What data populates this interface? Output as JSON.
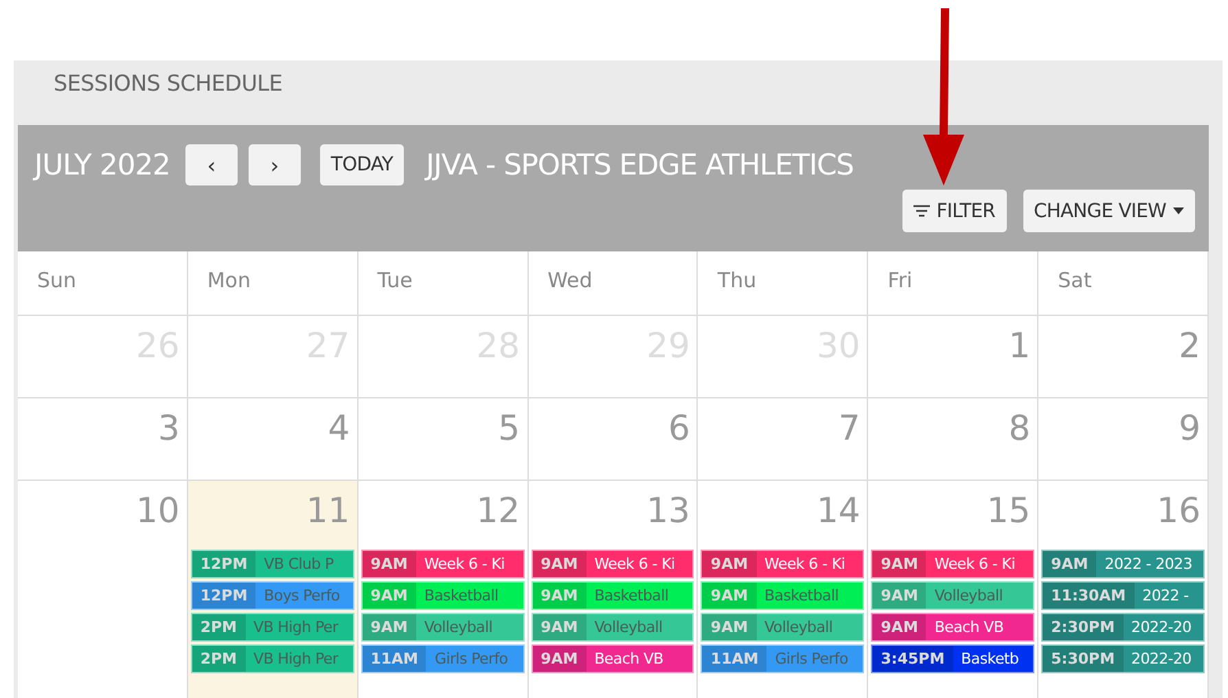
{
  "page_title": "SESSIONS SCHEDULE",
  "toolbar": {
    "month": "JULY 2022",
    "prev": "‹",
    "next": "›",
    "today": "TODAY",
    "venue": "JJVA - SPORTS EDGE ATHLETICS",
    "filter": "FILTER",
    "change_view": "CHANGE VIEW"
  },
  "weekdays": [
    "Sun",
    "Mon",
    "Tue",
    "Wed",
    "Thu",
    "Fri",
    "Sat"
  ],
  "weeks": [
    {
      "days": [
        {
          "number": "26",
          "other_month": true,
          "today": false
        },
        {
          "number": "27",
          "other_month": true,
          "today": false
        },
        {
          "number": "28",
          "other_month": true,
          "today": false
        },
        {
          "number": "29",
          "other_month": true,
          "today": false
        },
        {
          "number": "30",
          "other_month": true,
          "today": false
        },
        {
          "number": "1",
          "other_month": false,
          "today": false
        },
        {
          "number": "2",
          "other_month": false,
          "today": false
        }
      ]
    },
    {
      "days": [
        {
          "number": "3",
          "other_month": false,
          "today": false
        },
        {
          "number": "4",
          "other_month": false,
          "today": false
        },
        {
          "number": "5",
          "other_month": false,
          "today": false
        },
        {
          "number": "6",
          "other_month": false,
          "today": false
        },
        {
          "number": "7",
          "other_month": false,
          "today": false
        },
        {
          "number": "8",
          "other_month": false,
          "today": false
        },
        {
          "number": "9",
          "other_month": false,
          "today": false
        }
      ]
    },
    {
      "days": [
        {
          "number": "10",
          "other_month": false,
          "today": false
        },
        {
          "number": "11",
          "other_month": false,
          "today": true,
          "events": [
            {
              "time": "12PM",
              "title": "VB Club P",
              "color": "#19c08e"
            },
            {
              "time": "12PM",
              "title": "Boys Perfo",
              "color": "#3399f5"
            },
            {
              "time": "2PM",
              "title": "VB High Per",
              "color": "#19c08e"
            },
            {
              "time": "2PM",
              "title": "VB High Per",
              "color": "#19c08e"
            }
          ]
        },
        {
          "number": "12",
          "other_month": false,
          "today": false,
          "events": [
            {
              "time": "9AM",
              "title": "Week 6 - Ki",
              "color": "#ff2d6b"
            },
            {
              "time": "9AM",
              "title": "Basketball",
              "color": "#00ee55"
            },
            {
              "time": "9AM",
              "title": "Volleyball",
              "color": "#35c795"
            },
            {
              "time": "11AM",
              "title": "Girls Perfo",
              "color": "#3399f5"
            }
          ]
        },
        {
          "number": "13",
          "other_month": false,
          "today": false,
          "events": [
            {
              "time": "9AM",
              "title": "Week 6 - Ki",
              "color": "#ff2d6b"
            },
            {
              "time": "9AM",
              "title": "Basketball",
              "color": "#00ee55"
            },
            {
              "time": "9AM",
              "title": "Volleyball",
              "color": "#35c795"
            },
            {
              "time": "9AM",
              "title": "Beach VB",
              "color": "#f0288f"
            }
          ]
        },
        {
          "number": "14",
          "other_month": false,
          "today": false,
          "events": [
            {
              "time": "9AM",
              "title": "Week 6 - Ki",
              "color": "#ff2d6b"
            },
            {
              "time": "9AM",
              "title": "Basketball",
              "color": "#00ee55"
            },
            {
              "time": "9AM",
              "title": "Volleyball",
              "color": "#35c795"
            },
            {
              "time": "11AM",
              "title": "Girls Perfo",
              "color": "#3399f5"
            }
          ]
        },
        {
          "number": "15",
          "other_month": false,
          "today": false,
          "events": [
            {
              "time": "9AM",
              "title": "Week 6 - Ki",
              "color": "#ff2d6b"
            },
            {
              "time": "9AM",
              "title": "Volleyball",
              "color": "#35c795"
            },
            {
              "time": "9AM",
              "title": "Beach VB",
              "color": "#f0288f"
            },
            {
              "time": "3:45PM",
              "title": "Basketb",
              "color": "#0030f0"
            }
          ]
        },
        {
          "number": "16",
          "other_month": false,
          "today": false,
          "events": [
            {
              "time": "9AM",
              "title": "2022 - 2023",
              "color": "#27958d"
            },
            {
              "time": "11:30AM",
              "title": "2022 -",
              "color": "#27958d"
            },
            {
              "time": "2:30PM",
              "title": "2022-20",
              "color": "#27958d"
            },
            {
              "time": "5:30PM",
              "title": "2022-20",
              "color": "#27958d"
            }
          ]
        }
      ]
    }
  ]
}
